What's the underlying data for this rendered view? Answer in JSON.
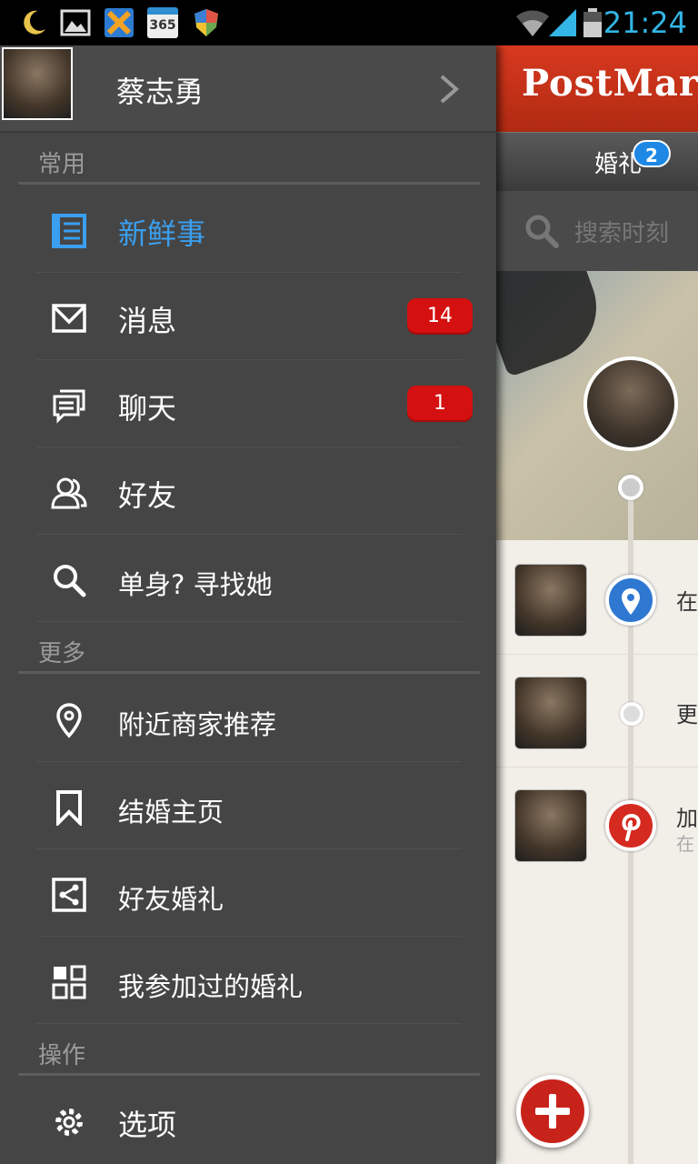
{
  "statusbar": {
    "time": "21:24",
    "left_icons": [
      "moon-icon",
      "gallery-icon",
      "app-x-icon",
      "calendar-365-icon",
      "shield-icon"
    ],
    "calendar_text": "365",
    "right_icons": [
      "wifi-icon",
      "signal-icon",
      "battery-icon"
    ],
    "accent_color": "#33b5e5"
  },
  "drawer": {
    "profile": {
      "name": "蔡志勇"
    },
    "sections": {
      "common": "常用",
      "more": "更多",
      "actions": "操作"
    },
    "items": {
      "news": {
        "label": "新鲜事",
        "icon": "newsfeed-icon",
        "active": true
      },
      "messages": {
        "label": "消息",
        "icon": "mail-icon",
        "badge": "14"
      },
      "chat": {
        "label": "聊天",
        "icon": "chat-icon",
        "badge": "1"
      },
      "friends": {
        "label": "好友",
        "icon": "friends-icon"
      },
      "single": {
        "label": "单身? 寻找她",
        "icon": "search-icon"
      },
      "nearby": {
        "label": "附近商家推荐",
        "icon": "location-pin-icon"
      },
      "wedding_home": {
        "label": "结婚主页",
        "icon": "bookmark-icon"
      },
      "friend_weddings": {
        "label": "好友婚礼",
        "icon": "share-icon"
      },
      "attended": {
        "label": "我参加过的婚礼",
        "icon": "grid-icon"
      },
      "options": {
        "label": "选项",
        "icon": "gear-icon"
      }
    },
    "active_color": "#3a9ff0",
    "badge_color": "#d41010"
  },
  "app": {
    "logo": "PostMarry",
    "tab": {
      "label": "婚礼",
      "badge": "2"
    },
    "search_placeholder": "搜索时刻",
    "feed": [
      {
        "text": "在",
        "marker": "location-pin-icon"
      },
      {
        "text": "更",
        "marker": "dot"
      },
      {
        "text": "加",
        "sub": "在",
        "marker": "pinterest-icon"
      }
    ],
    "header_color": "#c8301a"
  }
}
